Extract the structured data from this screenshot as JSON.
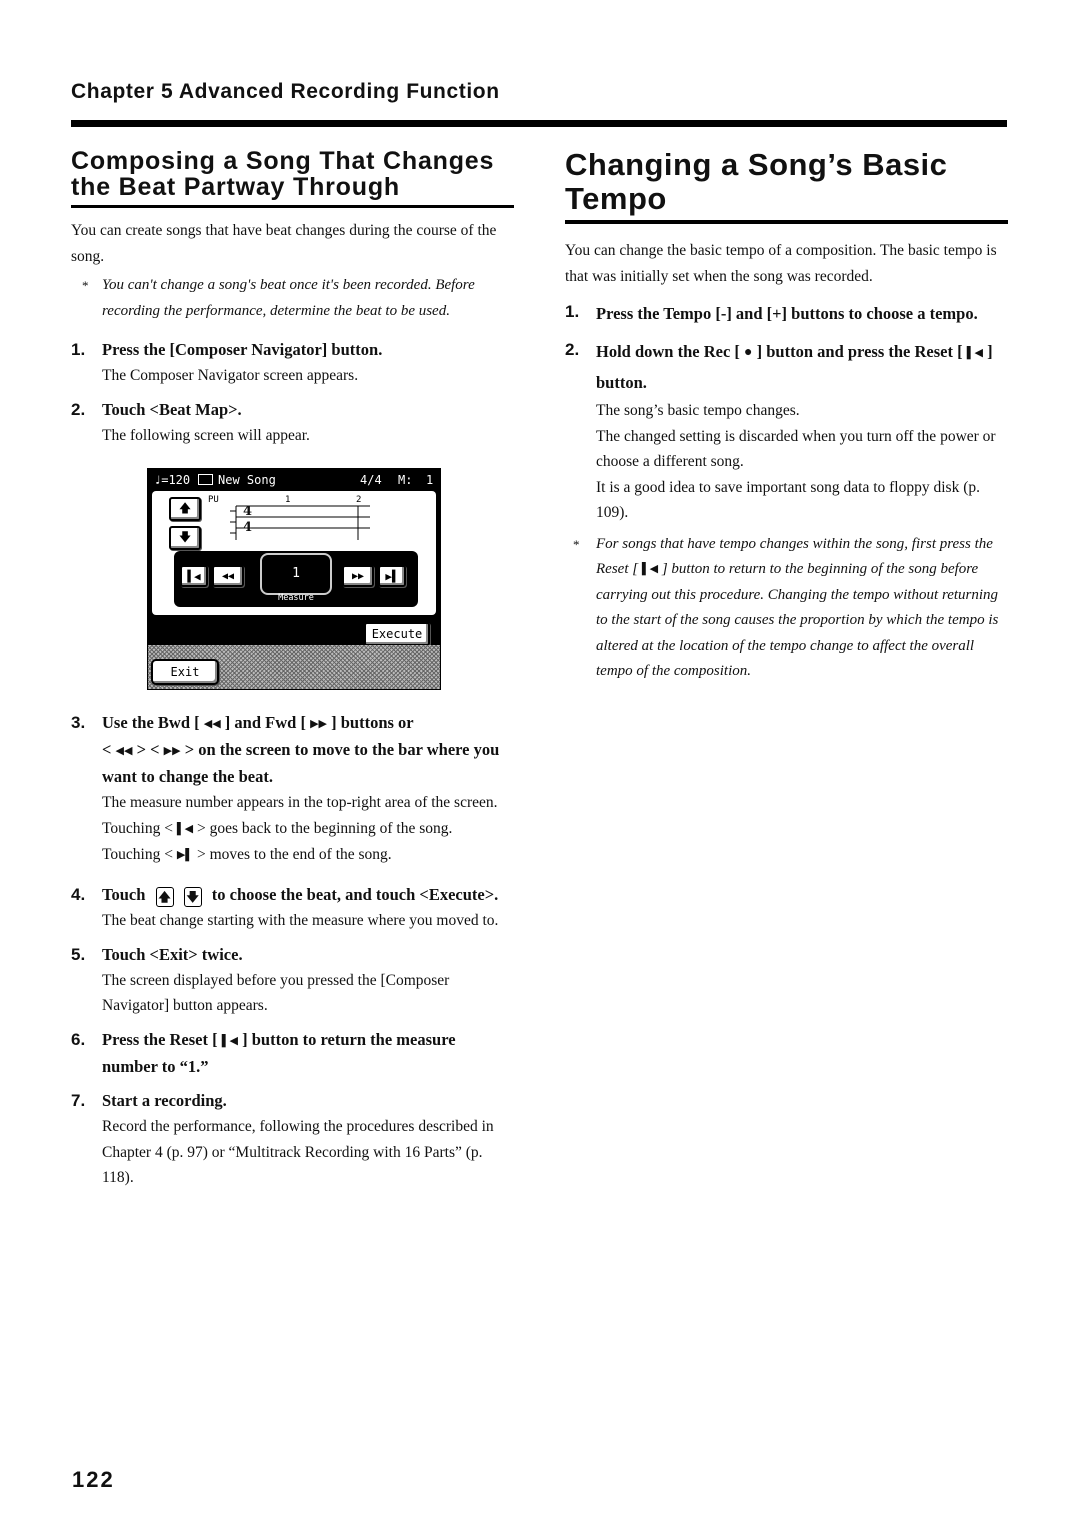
{
  "chapter_header": "Chapter 5 Advanced Recording Function",
  "page_number": "122",
  "left_section": {
    "title_line1": "Composing a Song That Changes",
    "title_line2": "the Beat Partway Through",
    "intro": "You can create songs that have beat changes during the course of the song.",
    "note": "You can't change a song's beat once it's been recorded. Before recording the performance, determine the beat to be used.",
    "note_marker": "*",
    "steps": [
      {
        "num": "1.",
        "head": "Press the [Composer Navigator] button.",
        "desc": "The Composer Navigator screen appears."
      },
      {
        "num": "2.",
        "head": "Touch <Beat Map>.",
        "desc": "The following screen will appear."
      },
      {
        "num": "3.",
        "head_parts": [
          "Use the Bwd [",
          "] and Fwd [",
          "] buttons or",
          "<",
          "> <",
          "> on the screen to move to the bar where you want to change the beat."
        ],
        "desc": "The measure number appears in the top-right area of the screen.",
        "touch_start": {
          "pre": "Touching <",
          "post": "> goes back to the beginning of the song."
        },
        "touch_end": {
          "pre": "Touching <",
          "post": "> moves to the end of the song."
        }
      },
      {
        "num": "4.",
        "head_parts": [
          "Touch",
          "to choose the beat, and touch <Execute>."
        ],
        "desc": "The beat change starting with the measure where you moved to."
      },
      {
        "num": "5.",
        "head": "Touch <Exit> twice.",
        "desc": "The screen displayed before you pressed the [Composer Navigator] button appears."
      },
      {
        "num": "6.",
        "head_parts": [
          "Press the Reset [",
          "] button to return the measure number to “1.”"
        ]
      },
      {
        "num": "7.",
        "head": "Start a recording.",
        "desc": "Record the performance, following the procedures described in Chapter 4 (p. 97) or “Multitrack Recording with 16 Parts” (p. 118)."
      }
    ]
  },
  "lcd_screen": {
    "tempo": "♩=120",
    "song_icon": "book-icon",
    "song_name": "New Song",
    "beat": "4/4",
    "measure_label_top": "M:",
    "measure_top": "1",
    "part_label": "PU",
    "bar_numbers": [
      "1",
      "2"
    ],
    "time_signature": {
      "numerator": "4",
      "denominator": "4"
    },
    "measure_value": "1",
    "measure_caption": "Measure",
    "execute_label": "Execute",
    "exit_label": "Exit"
  },
  "right_section": {
    "title_line1": "Changing a Song’s Basic",
    "title_line2": "Tempo",
    "intro": "You can change the basic tempo of a composition. The basic tempo is that was initially set when the song was recorded.",
    "steps": [
      {
        "num": "1.",
        "head": "Press the Tempo [-] and [+] buttons to choose a tempo."
      },
      {
        "num": "2.",
        "head_parts": [
          "Hold down the Rec [",
          "] button and press the Reset [",
          "] button."
        ],
        "desc": [
          "The song’s basic tempo changes.",
          "The changed setting is discarded when you turn off the power or choose a different song.",
          "It is a good idea to save important song data to floppy disk (p. 109)."
        ]
      }
    ],
    "note_marker": "*",
    "note_parts": [
      "For songs that have tempo changes within the song, first press the Reset [",
      "] button to return to the beginning of the song before carrying out this procedure. Changing the tempo without returning to the start of the song causes the proportion by which the tempo is altered at the location of the tempo change to affect the overall tempo of the composition."
    ]
  }
}
